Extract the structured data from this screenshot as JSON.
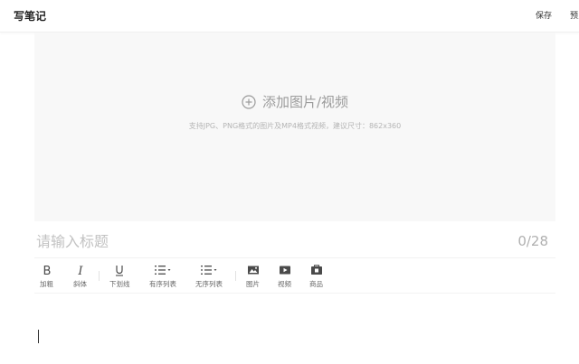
{
  "header": {
    "title": "写笔记",
    "save_label": "保存",
    "preview_label": "预览"
  },
  "upload": {
    "icon": "plus-circle-icon",
    "label": "添加图片/视频",
    "hint": "支持JPG、PNG格式的图片及MP4格式视频，建议尺寸：862x360"
  },
  "title_field": {
    "placeholder": "请输入标题",
    "value": "",
    "counter": "0/28"
  },
  "toolbar": {
    "bold": {
      "icon": "bold-icon",
      "label": "加粗"
    },
    "italic": {
      "icon": "italic-icon",
      "label": "斜体"
    },
    "underline": {
      "icon": "underline-icon",
      "label": "下划线"
    },
    "ordered_list": {
      "icon": "ordered-list-icon",
      "label": "有序列表"
    },
    "unordered_list": {
      "icon": "unordered-list-icon",
      "label": "无序列表"
    },
    "image": {
      "icon": "image-icon",
      "label": "图片"
    },
    "video": {
      "icon": "video-icon",
      "label": "视频"
    },
    "product": {
      "icon": "product-icon",
      "label": "商品"
    }
  },
  "editor": {
    "content": ""
  },
  "colors": {
    "upload_bg": "#f8f8f8",
    "muted_text": "#9b9b9b",
    "icon_dark": "#4a4a4a"
  }
}
